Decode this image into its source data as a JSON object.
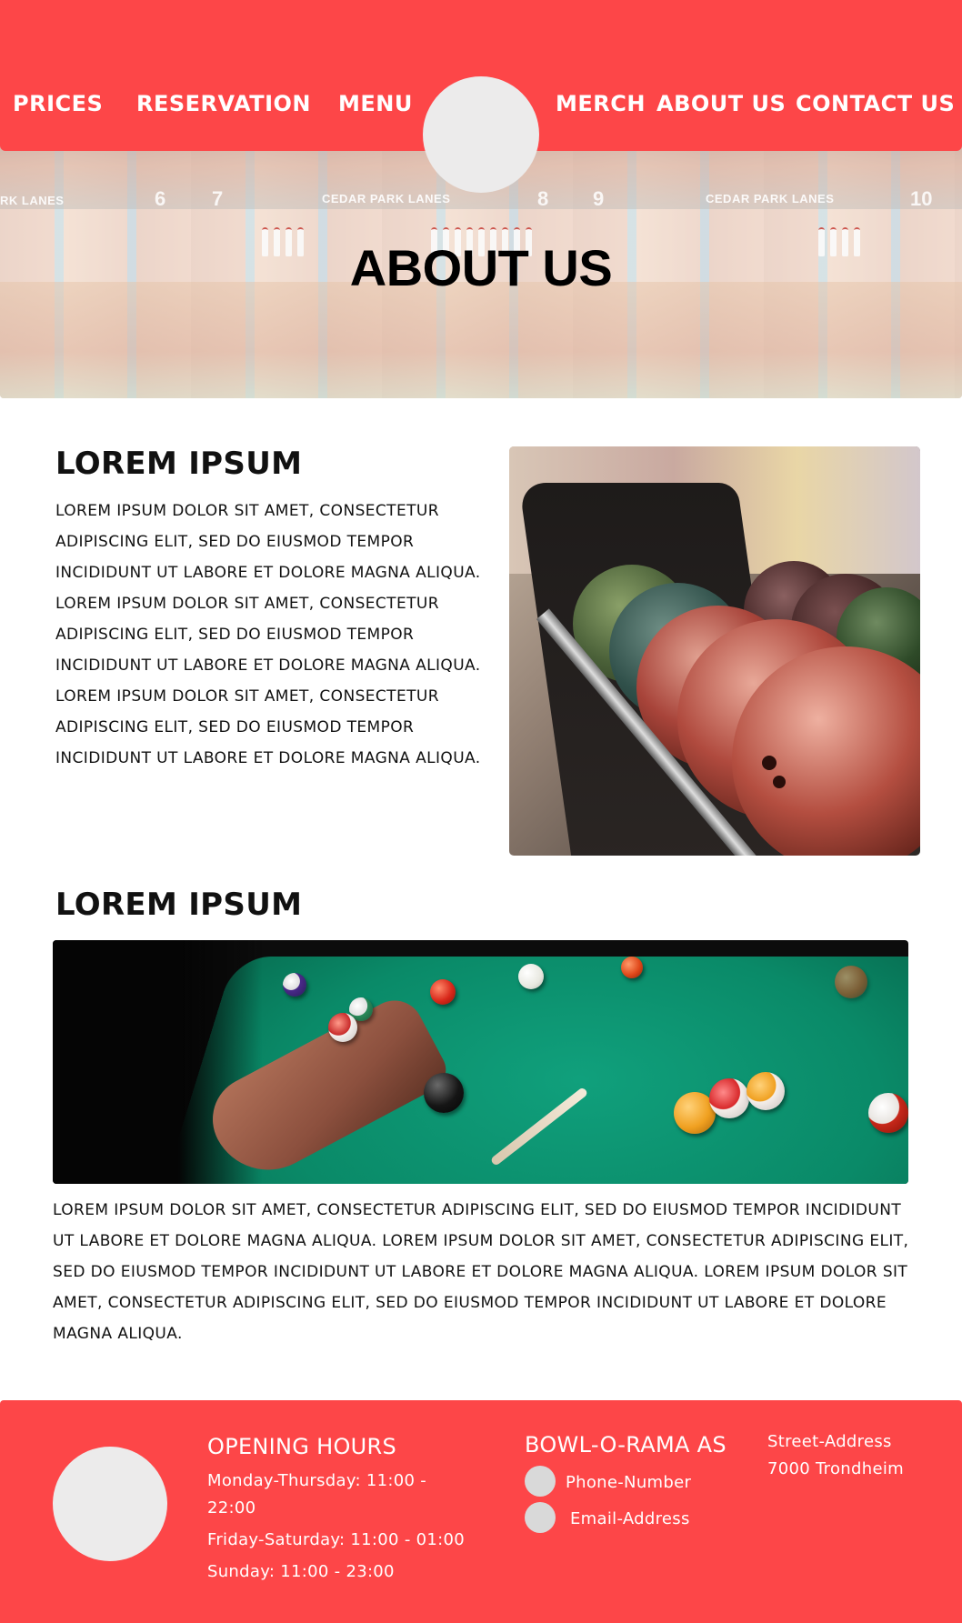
{
  "nav": {
    "items": [
      {
        "label": "PRICES"
      },
      {
        "label": "RESERVATION"
      },
      {
        "label": "MENU"
      },
      {
        "label": "MERCH"
      },
      {
        "label": "ABOUT US"
      },
      {
        "label": "CONTACT US"
      }
    ]
  },
  "hero": {
    "title": "ABOUT US",
    "lane_signs": [
      "RK LANES",
      "CEDAR PARK LANES",
      "CEDAR PARK LANES"
    ],
    "lane_numbers": [
      "6",
      "7",
      "8",
      "9",
      "10"
    ]
  },
  "section1": {
    "heading": "LOREM IPSUM",
    "paragraph": "LOREM IPSUM DOLOR SIT AMET, CONSECTETUR ADIPISCING ELIT, SED DO EIUSMOD TEMPOR INCIDIDUNT UT LABORE ET DOLORE MAGNA ALIQUA. LOREM IPSUM DOLOR SIT AMET, CONSECTETUR ADIPISCING ELIT, SED DO EIUSMOD TEMPOR INCIDIDUNT UT LABORE ET DOLORE MAGNA ALIQUA. LOREM IPSUM DOLOR SIT AMET, CONSECTETUR ADIPISCING ELIT, SED DO EIUSMOD TEMPOR INCIDIDUNT UT LABORE ET DOLORE MAGNA ALIQUA."
  },
  "section2": {
    "heading": "LOREM IPSUM",
    "paragraph": "LOREM IPSUM DOLOR SIT AMET, CONSECTETUR ADIPISCING ELIT, SED DO EIUSMOD TEMPOR INCIDIDUNT UT LABORE ET DOLORE MAGNA ALIQUA. LOREM IPSUM DOLOR SIT AMET, CONSECTETUR ADIPISCING ELIT, SED DO EIUSMOD TEMPOR INCIDIDUNT UT LABORE ET DOLORE MAGNA ALIQUA. LOREM IPSUM DOLOR SIT AMET, CONSECTETUR ADIPISCING ELIT, SED DO EIUSMOD TEMPOR INCIDIDUNT UT LABORE ET DOLORE MAGNA ALIQUA."
  },
  "footer": {
    "hours_heading": "OPENING HOURS",
    "hours": [
      "Monday-Thursday: 11:00 - 22:00",
      "Friday-Saturday: 11:00 - 01:00",
      "Sunday: 11:00 - 23:00"
    ],
    "company": "BOWL-O-RAMA AS",
    "phone": "Phone-Number",
    "email": "Email-Address",
    "street": "Street-Address",
    "city": "7000 Trondheim"
  },
  "colors": {
    "brand_red": "#fd4648",
    "placeholder_grey": "#ecebeb",
    "icon_grey": "#d9d9d9"
  },
  "icons": {
    "logo": "logo-placeholder-circle",
    "phone": "phone-icon",
    "email": "email-icon"
  }
}
